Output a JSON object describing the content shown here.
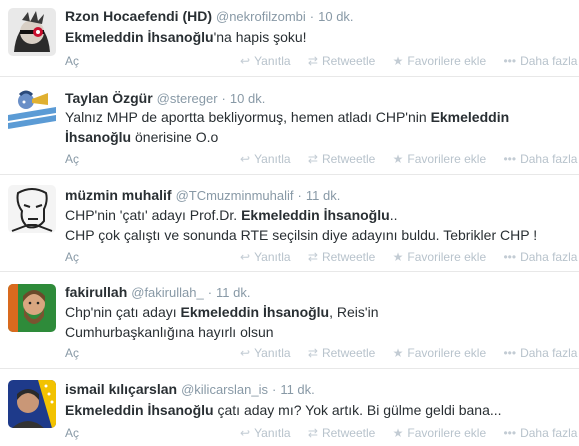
{
  "actions": {
    "reply": "Yanıtla",
    "retweet": "Retweetle",
    "favorite": "Favorilere ekle",
    "more": "Daha fazla",
    "expand": "Aç"
  },
  "tweets": [
    {
      "name": "Rzon Hocaefendi (HD)",
      "handle": "@nekrofilzombi",
      "time": "10 dk.",
      "text": [
        {
          "b": "Ekmeleddin İhsanoğlu"
        },
        {
          "t": "'na hapis şoku!"
        }
      ]
    },
    {
      "name": "Taylan Özgür",
      "handle": "@stereger",
      "time": "10 dk.",
      "text": [
        {
          "t": "Yalnız MHP de aportta bekliyormuş, hemen atladı CHP'nin "
        },
        {
          "b": "Ekmeleddin İhsanoğlu"
        },
        {
          "t": " önerisine O.o"
        }
      ]
    },
    {
      "name": "müzmin muhalif",
      "handle": "@TCmuzminmuhalif",
      "time": "11 dk.",
      "text": [
        {
          "t": "CHP'nin 'çatı' adayı Prof.Dr. "
        },
        {
          "b": "Ekmeleddin İhsanoğlu"
        },
        {
          "t": ".."
        },
        {
          "br": true
        },
        {
          "t": "CHP çok çalıştı ve sonunda RTE seçilsin diye adayını buldu. Tebrikler CHP !"
        }
      ]
    },
    {
      "name": "fakirullah",
      "handle": "@fakirullah_",
      "time": "11 dk.",
      "text": [
        {
          "t": "Chp'nin çatı adayı "
        },
        {
          "b": "Ekmeleddin İhsanoğlu"
        },
        {
          "t": ", Reis'in Cumhurbaşkanlığına hayırlı olsun"
        }
      ]
    },
    {
      "name": "ismail kılıçarslan",
      "handle": "@kilicarslan_is",
      "time": "11 dk.",
      "text": [
        {
          "b": "Ekmeleddin İhsanoğlu"
        },
        {
          "t": " çatı aday mı? Yok artık. Bi gülme geldi bana..."
        }
      ]
    }
  ]
}
